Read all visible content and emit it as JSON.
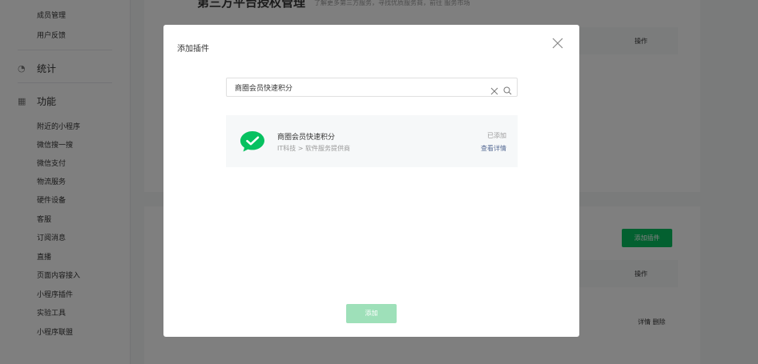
{
  "sidebar": {
    "top_items": [
      "成员管理",
      "用户反馈"
    ],
    "group_stats": {
      "label": "统计",
      "icon": "pie-chart-icon"
    },
    "group_features": {
      "label": "功能",
      "icon": "grid-icon"
    },
    "feature_items": [
      "附近的小程序",
      "微信搜一搜",
      "微信支付",
      "物流服务",
      "硬件设备",
      "客服",
      "订阅消息",
      "直播",
      "页面内容接入",
      "小程序插件",
      "实验工具",
      "小程序联盟"
    ]
  },
  "background": {
    "heading": "第三方平台授权管理",
    "heading_tip": "了解更多第三方服务，寻找优质服务商，前往 服务市场",
    "operation_header": "操作",
    "add_plugin_button": "添加插件",
    "row_links": "详情 删除"
  },
  "dialog": {
    "title": "添加插件",
    "close_icon": "close-icon",
    "search": {
      "value": "商圈会员快速积分",
      "clear_icon": "clear-icon",
      "search_icon": "search-icon"
    },
    "result": {
      "name": "商圈会员快速积分",
      "category": "IT科技 > 软件服务提供商",
      "status": "已添加",
      "detail_link": "查看详情",
      "logo_icon": "checkmark-bubble-icon"
    },
    "add_button": "添加"
  },
  "colors": {
    "brand_green": "#07c160",
    "disabled_green": "#9ee0b9",
    "link_blue": "#576b95",
    "overlay": "rgba(0,0,0,0.5)"
  }
}
